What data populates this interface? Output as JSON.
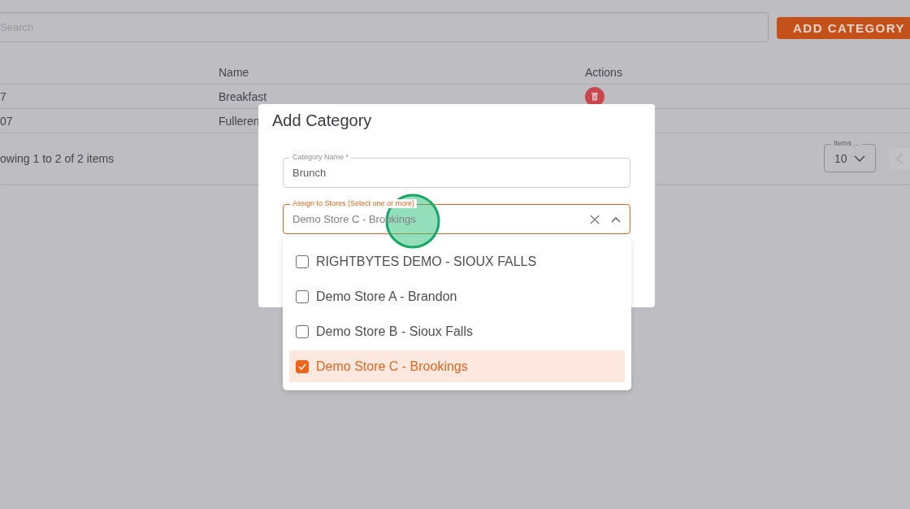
{
  "page": {
    "search": {
      "placeholder": "Search"
    },
    "add_button": "ADD CATEGORY",
    "table": {
      "columns": [
        {
          "label": "Name"
        },
        {
          "label": "Actions"
        }
      ],
      "rows": [
        {
          "column_1": "7",
          "name": "Breakfast",
          "actions": [
            {
              "kind": "delete"
            }
          ]
        },
        {
          "column_1": "07",
          "name": "Fulleren"
        }
      ]
    },
    "summary": "owing 1 to 2 of 2 items",
    "items_per_page": {
      "label": "Items ...",
      "value": "10"
    }
  },
  "dialog": {
    "title": "Add Category",
    "fields": [
      {
        "kind": "text",
        "label": "Category Name *",
        "value": "Brunch",
        "focused": false
      },
      {
        "kind": "multiselect",
        "label": "Assign to Stores (Select one or more)",
        "value": "Demo Store C - Brookings",
        "focused": true,
        "expanded": true
      }
    ],
    "options": [
      {
        "label": "RIGHTBYTES DEMO - SIOUX FALLS",
        "checked": false,
        "selected": false
      },
      {
        "label": "Demo Store A - Brandon",
        "checked": false,
        "selected": false
      },
      {
        "label": "Demo Store B - Sioux Falls",
        "checked": false,
        "selected": false
      },
      {
        "label": "Demo Store C - Brookings",
        "checked": true,
        "selected": true
      }
    ]
  }
}
